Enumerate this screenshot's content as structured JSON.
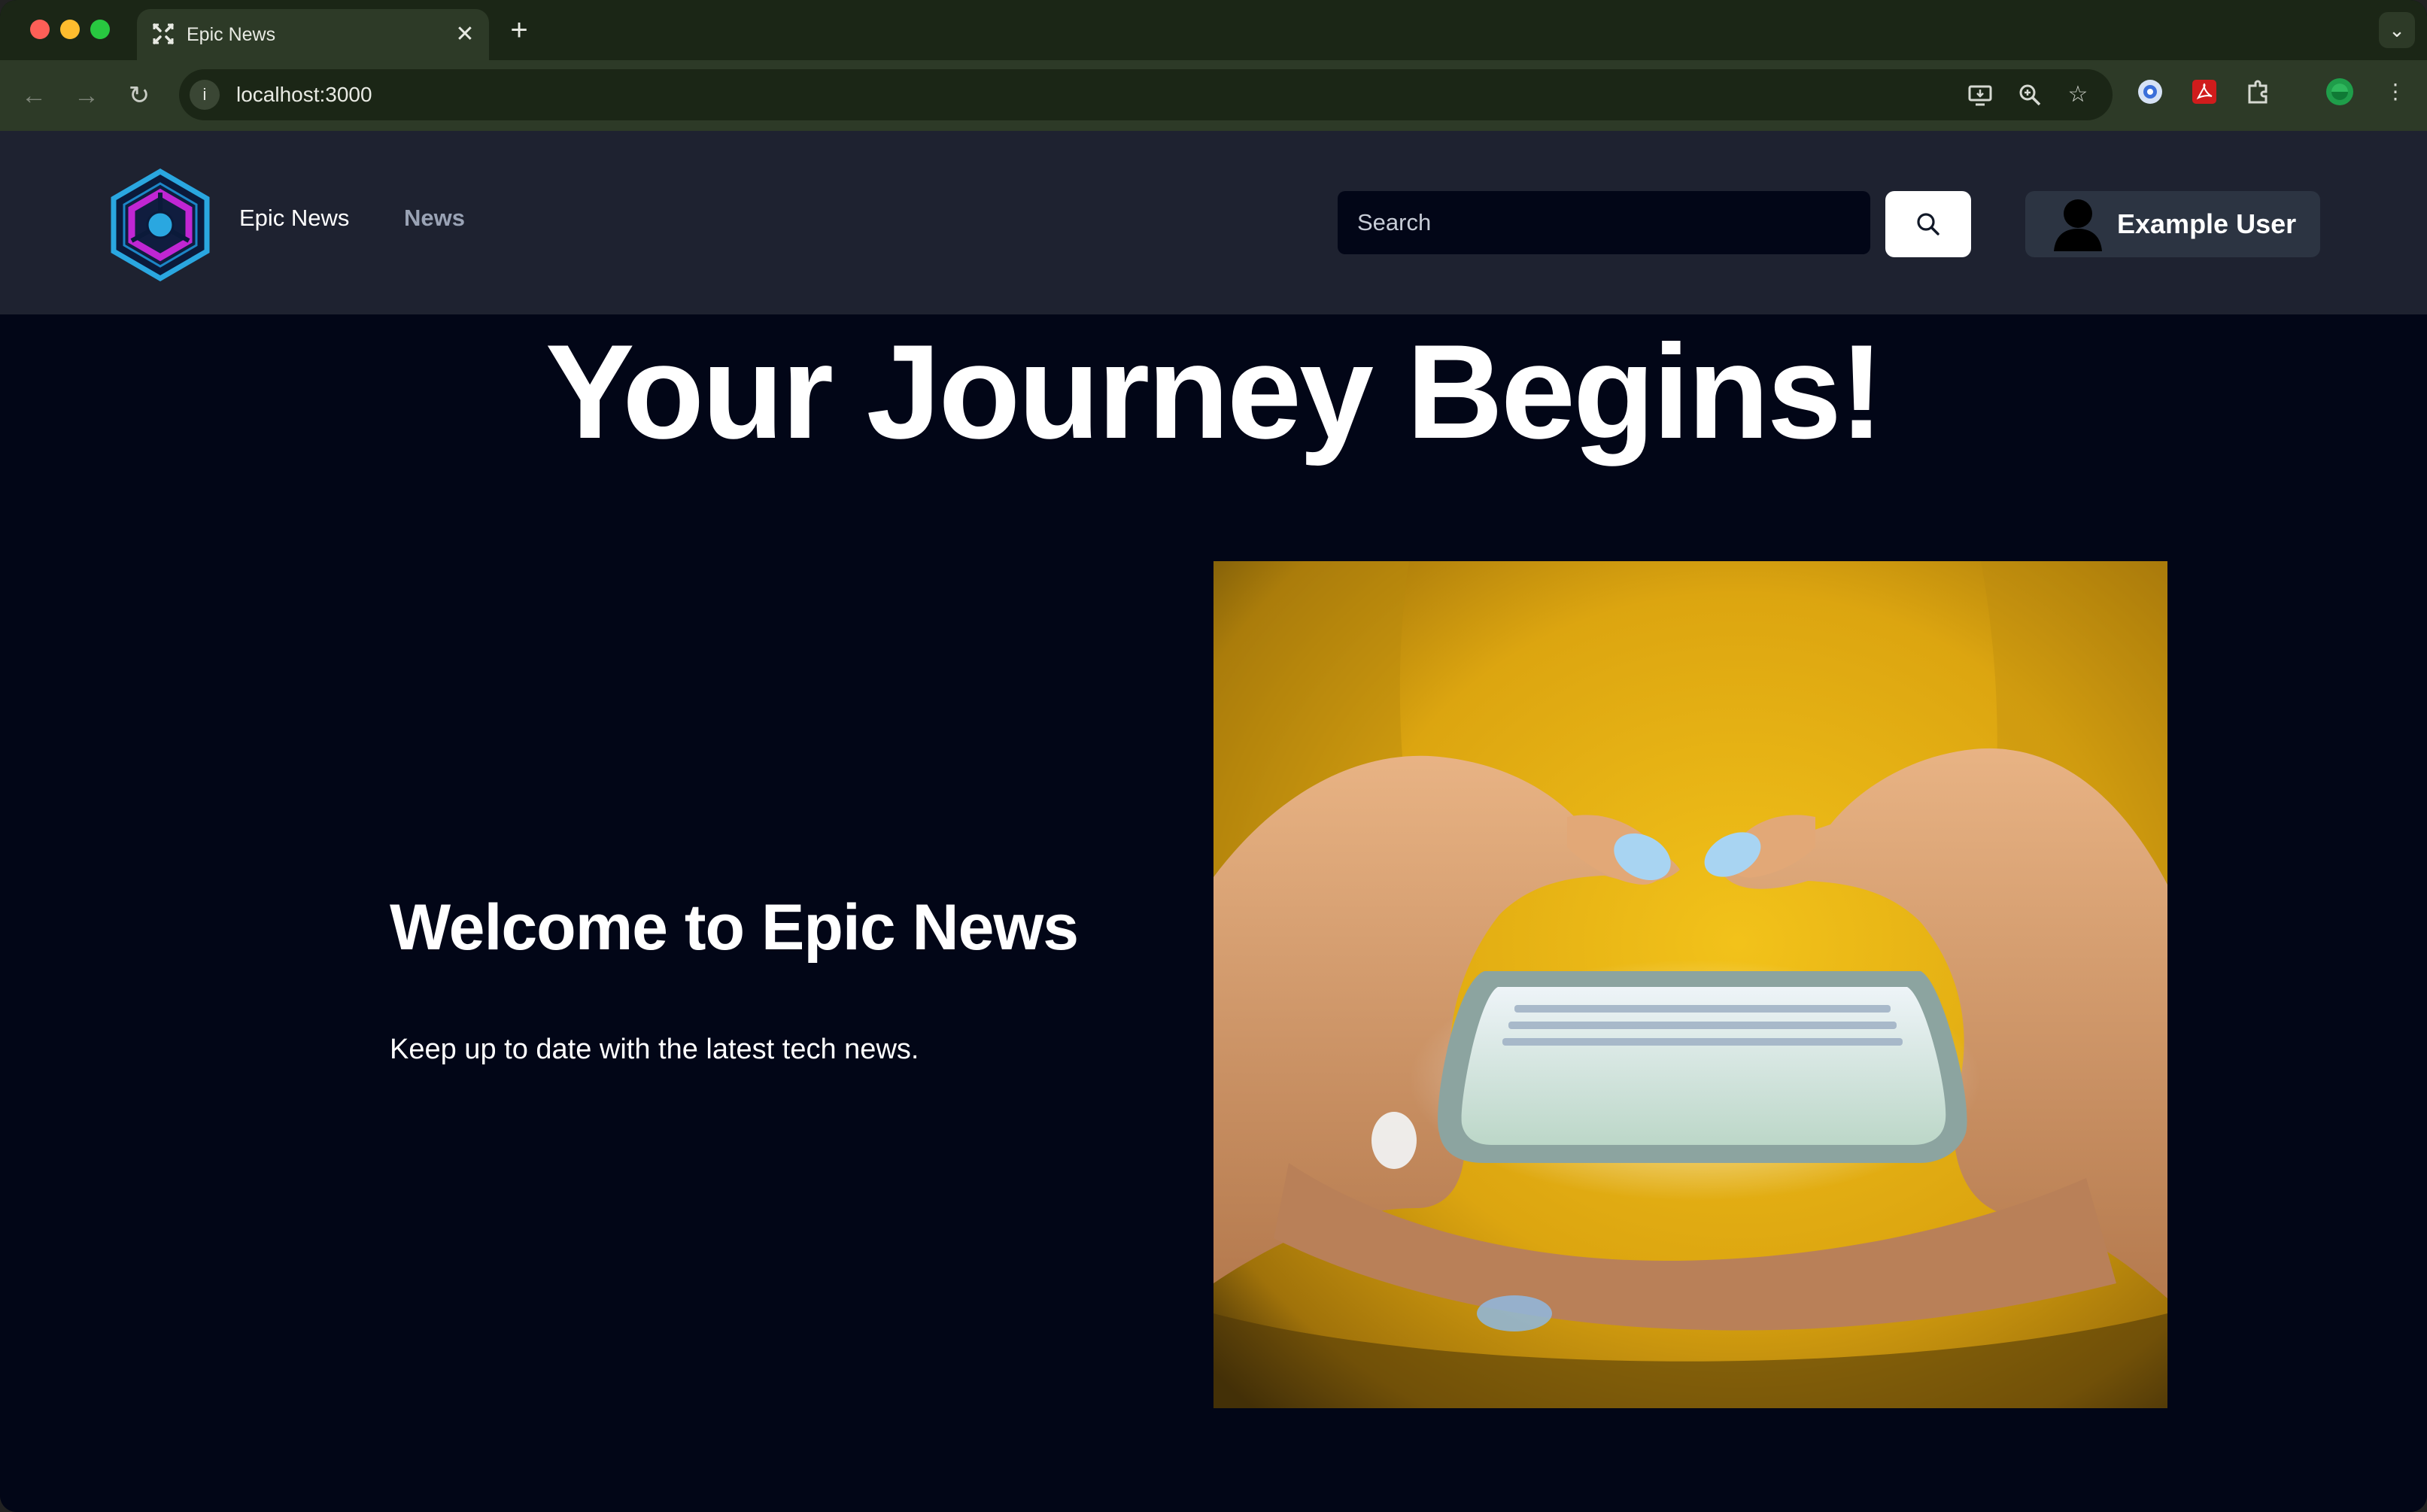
{
  "browser": {
    "tab_title": "Epic News",
    "tab_close": "✕",
    "new_tab": "+",
    "url": "localhost:3000"
  },
  "header": {
    "brand": "Epic News",
    "nav_news": "News",
    "search_placeholder": "Search",
    "user_name": "Example User"
  },
  "hero": {
    "title": "Your Journey Begins!",
    "welcome": "Welcome to Epic News",
    "tagline": "Keep up to date with the latest tech news.",
    "image_alt": "Hands holding a glowing smartphone in front of a yellow sweater"
  },
  "colors": {
    "page_bg": "#020617",
    "header_bg": "#1e2230",
    "user_button_bg": "#2c3442",
    "nav_link": "#9aa3b5"
  }
}
